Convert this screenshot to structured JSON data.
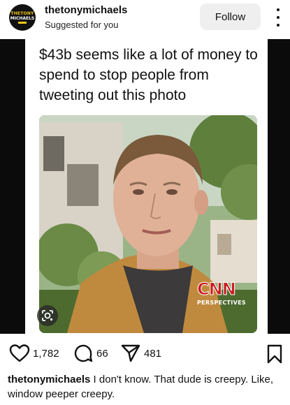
{
  "post": {
    "avatar": {
      "line1": "THETONY",
      "line2": "MICHAELS"
    },
    "username": "thetonymichaels",
    "subtitle": "Suggested for you",
    "follow_label": "Follow",
    "more_icon": "more-vertical-icon"
  },
  "media": {
    "tweet_text": "$43b seems like a lot of money to spend to stop people from tweeting out this photo",
    "overlay": {
      "logo": "CNN",
      "subtitle": "PERSPECTIVES"
    },
    "lens_icon": "visual-search-icon"
  },
  "actions": {
    "likes": "1,782",
    "comments": "66",
    "shares": "481"
  },
  "caption": {
    "user": "thetonymichaels",
    "text": "I don't know. That dude is creepy. Like, window peeper creepy."
  }
}
